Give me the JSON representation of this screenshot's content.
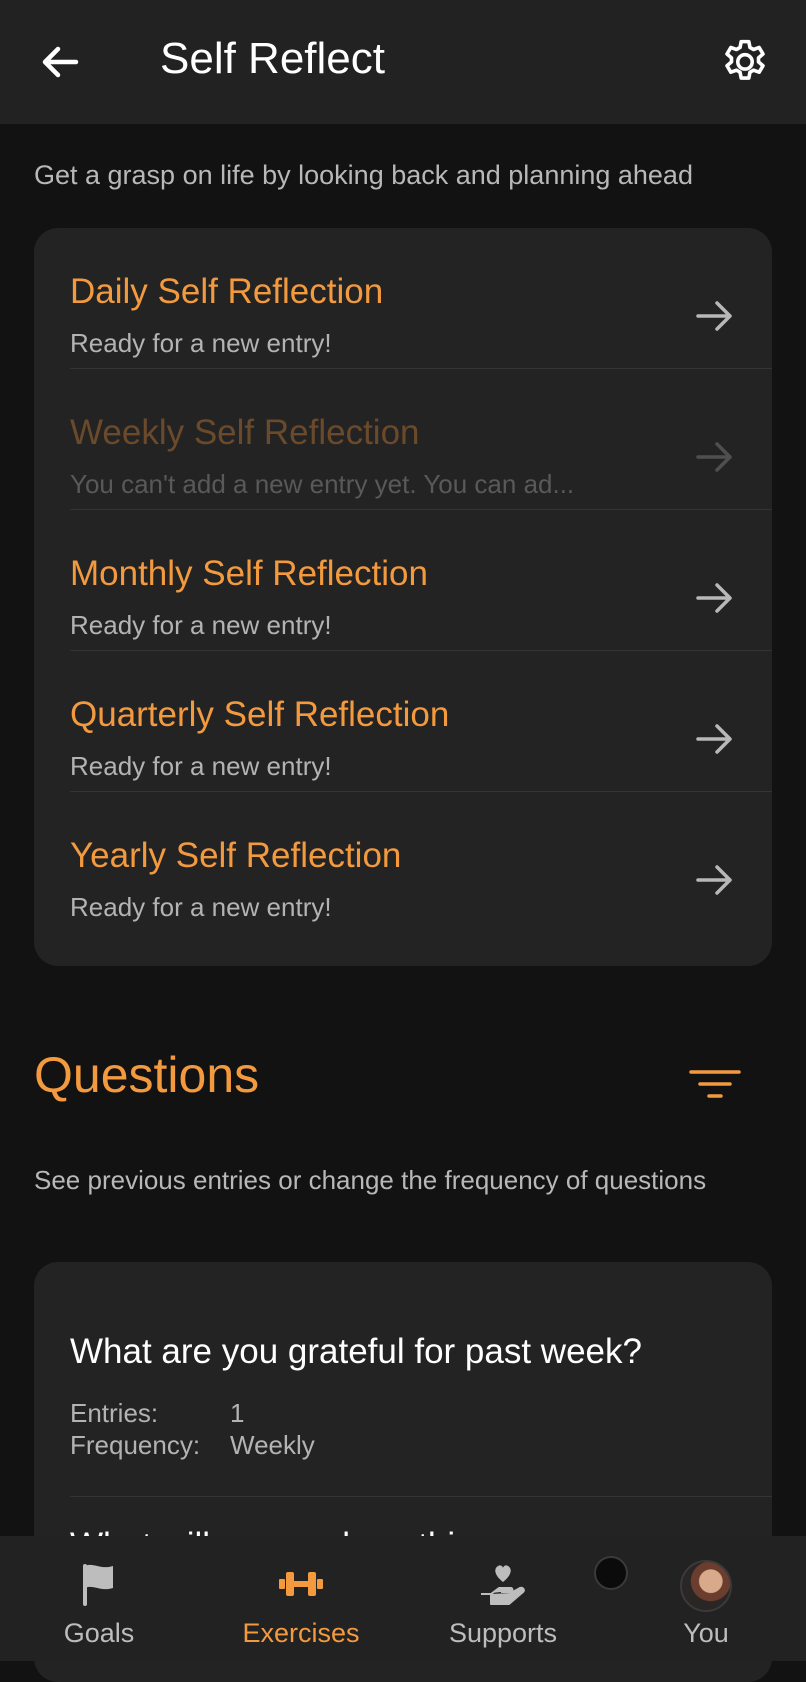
{
  "header": {
    "title": "Self Reflect"
  },
  "intro": "Get a grasp on life by looking back and planning ahead",
  "reflections": [
    {
      "title": "Daily Self Reflection",
      "status": "Ready for a new entry!"
    },
    {
      "title": "Weekly Self Reflection",
      "status": "You can't add a new entry yet. You can ad...",
      "disabled": true
    },
    {
      "title": "Monthly Self Reflection",
      "status": "Ready for a new entry!"
    },
    {
      "title": "Quarterly Self Reflection",
      "status": "Ready for a new entry!"
    },
    {
      "title": "Yearly Self Reflection",
      "status": "Ready for a new entry!"
    }
  ],
  "questions": {
    "heading": "Questions",
    "description": "See previous entries or change the frequency of questions",
    "items": [
      {
        "text": "What are you grateful for past week?",
        "entries_label": "Entries:",
        "entries_value": "1",
        "frequency_label": "Frequency:",
        "frequency_value": "Weekly"
      },
      {
        "text": "What will you work on this"
      }
    ]
  },
  "nav": {
    "items": [
      {
        "label": "Goals",
        "icon": "flag-icon"
      },
      {
        "label": "Exercises",
        "icon": "dumbbell-icon",
        "active": true
      },
      {
        "label": "Supports",
        "icon": "heart-hand-icon"
      },
      {
        "label": "You",
        "icon": "avatar"
      }
    ]
  },
  "colors": {
    "accent": "#f39a3f",
    "background": "#121212",
    "surface": "#232323",
    "bar": "#222222"
  }
}
